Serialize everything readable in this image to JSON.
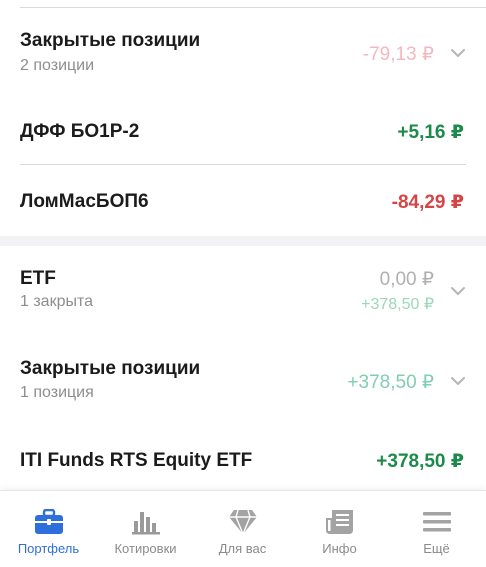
{
  "colors": {
    "positive": "#1b8a4a",
    "negative": "#d64545",
    "faded_negative": "#f3b8bf",
    "faded_positive": "#9ad8b8",
    "muted": "#b0b0b0",
    "active_tab": "#2f6fdc",
    "inactive_tab": "#8a8a8a"
  },
  "groups": [
    {
      "title": "Закрытые позиции",
      "subtitle": "2 позиции",
      "amount": "-79,13 ₽",
      "icon": "chevron-down-icon"
    },
    {
      "title": "ETF",
      "subtitle": "1 закрыта",
      "amount": "0,00 ₽",
      "amount_sub": "+378,50 ₽",
      "icon": "chevron-down-icon"
    },
    {
      "title": "Закрытые позиции",
      "subtitle": "1 позиция",
      "amount": "+378,50 ₽",
      "icon": "chevron-down-icon"
    }
  ],
  "positions": [
    {
      "title": "ДФФ БО1Р-2",
      "amount": "+5,16 ₽"
    },
    {
      "title": "ЛомМасБОП6",
      "amount": "-84,29 ₽"
    },
    {
      "title": "ITI Funds RTS Equity ETF",
      "amount": "+378,50 ₽"
    }
  ],
  "tabbar": {
    "items": [
      {
        "label": "Портфель",
        "icon": "briefcase-icon",
        "active": true
      },
      {
        "label": "Котировки",
        "icon": "bar-chart-icon",
        "active": false
      },
      {
        "label": "Для вас",
        "icon": "diamond-icon",
        "active": false
      },
      {
        "label": "Инфо",
        "icon": "news-icon",
        "active": false
      },
      {
        "label": "Ещё",
        "icon": "menu-icon",
        "active": false
      }
    ]
  }
}
